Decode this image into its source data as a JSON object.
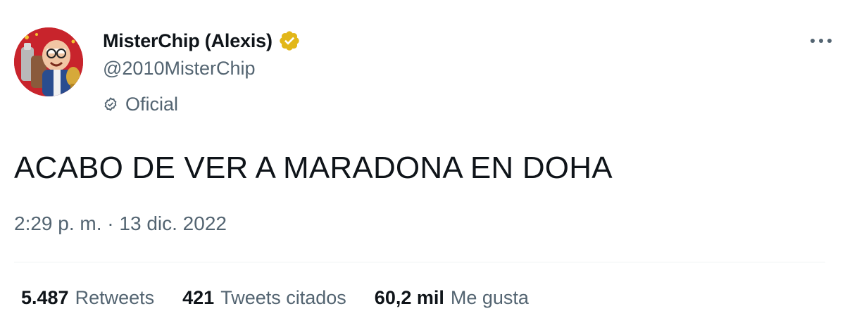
{
  "author": {
    "display_name": "MisterChip (Alexis)",
    "handle": "@2010MisterChip",
    "verified_badge_color": "#e2b719",
    "label": "Oficial"
  },
  "tweet": {
    "text": "ACABO DE VER A MARADONA EN DOHA",
    "timestamp": "2:29 p. m. · 13 dic. 2022"
  },
  "stats": [
    {
      "value": "5.487",
      "label": "Retweets"
    },
    {
      "value": "421",
      "label": "Tweets citados"
    },
    {
      "value": "60,2 mil",
      "label": "Me gusta"
    }
  ],
  "colors": {
    "text_primary": "#0f1419",
    "text_secondary": "#536471",
    "divider": "#eff3f4",
    "avatar_background": "#c8242c"
  },
  "icons": {
    "more": "more-horizontal-icon",
    "verified": "verified-badge-icon",
    "official": "official-check-icon"
  }
}
